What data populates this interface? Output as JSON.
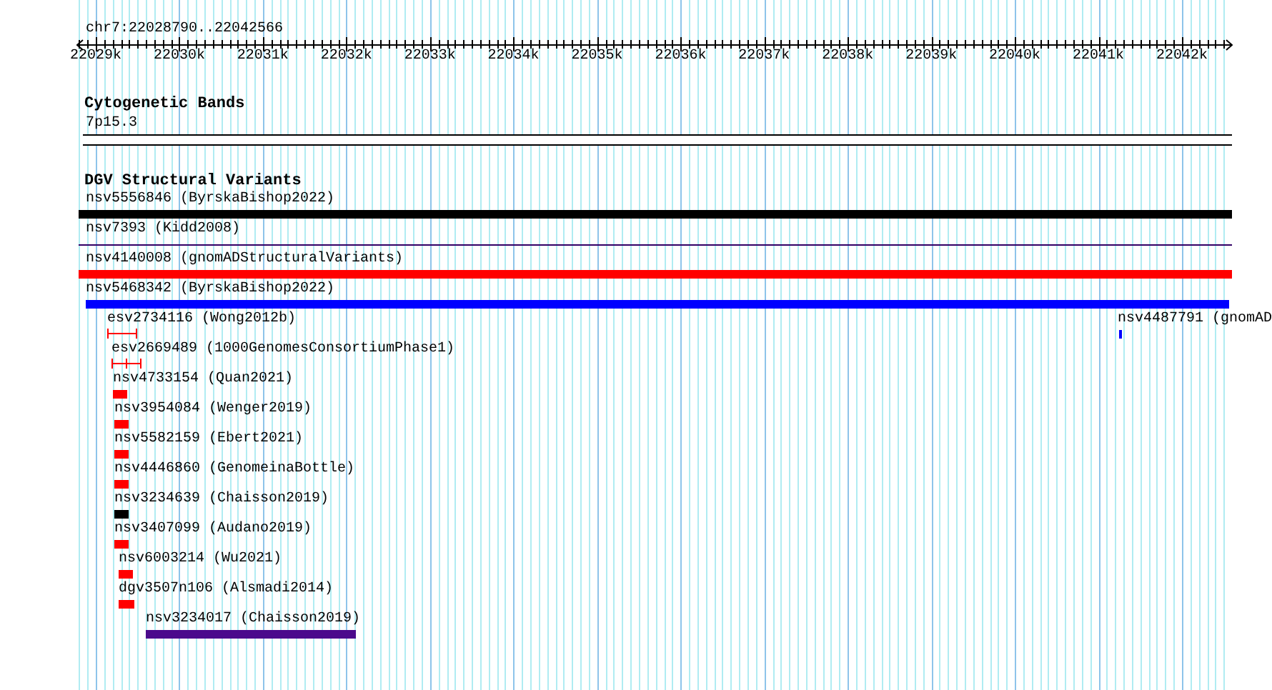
{
  "ruler": {
    "location": "chr7:22028790..22042566",
    "tick_labels": [
      "22029k",
      "22030k",
      "22031k",
      "22032k",
      "22033k",
      "22034k",
      "22035k",
      "22036k",
      "22037k",
      "22038k",
      "22039k",
      "22040k",
      "22041k",
      "22042k"
    ]
  },
  "cytoband_track": {
    "title": "Cytogenetic Bands",
    "band_label": "7p15.3"
  },
  "dgv_track": {
    "title": "DGV Structural Variants",
    "features": [
      {
        "label": "nsv5556846 (ByrskaBishop2022)",
        "color": "#000000",
        "kind": "bar"
      },
      {
        "label": "nsv7393 (Kidd2008)",
        "color": "#330066",
        "kind": "line"
      },
      {
        "label": "nsv4140008 (gnomADStructuralVariants)",
        "color": "#ff0000",
        "kind": "bar"
      },
      {
        "label": "nsv5468342 (ByrskaBishop2022)",
        "color": "#0000ff",
        "kind": "bar"
      },
      {
        "label": "esv2734116 (Wong2012b)",
        "color": "#ff0000",
        "kind": "interval"
      },
      {
        "label": "nsv4487791 (gnomAD",
        "color": "#0000ff",
        "kind": "bar"
      },
      {
        "label": "esv2669489 (1000GenomesConsortiumPhase1)",
        "color": "#ff0000",
        "kind": "split_interval"
      },
      {
        "label": "nsv4733154 (Quan2021)",
        "color": "#ff0000",
        "kind": "bar"
      },
      {
        "label": "nsv3954084 (Wenger2019)",
        "color": "#ff0000",
        "kind": "bar"
      },
      {
        "label": "nsv5582159 (Ebert2021)",
        "color": "#ff0000",
        "kind": "bar"
      },
      {
        "label": "nsv4446860 (GenomeinaBottle)",
        "color": "#ff0000",
        "kind": "bar"
      },
      {
        "label": "nsv3234639 (Chaisson2019)",
        "color": "#000000",
        "kind": "bar"
      },
      {
        "label": "nsv3407099 (Audano2019)",
        "color": "#ff0000",
        "kind": "bar"
      },
      {
        "label": "nsv6003214 (Wu2021)",
        "color": "#ff0000",
        "kind": "bar"
      },
      {
        "label": "dgv3507n106 (Alsmadi2014)",
        "color": "#ff0000",
        "kind": "bar"
      },
      {
        "label": "nsv3234017 (Chaisson2019)",
        "color": "#4b0a8c",
        "kind": "bar"
      }
    ]
  }
}
